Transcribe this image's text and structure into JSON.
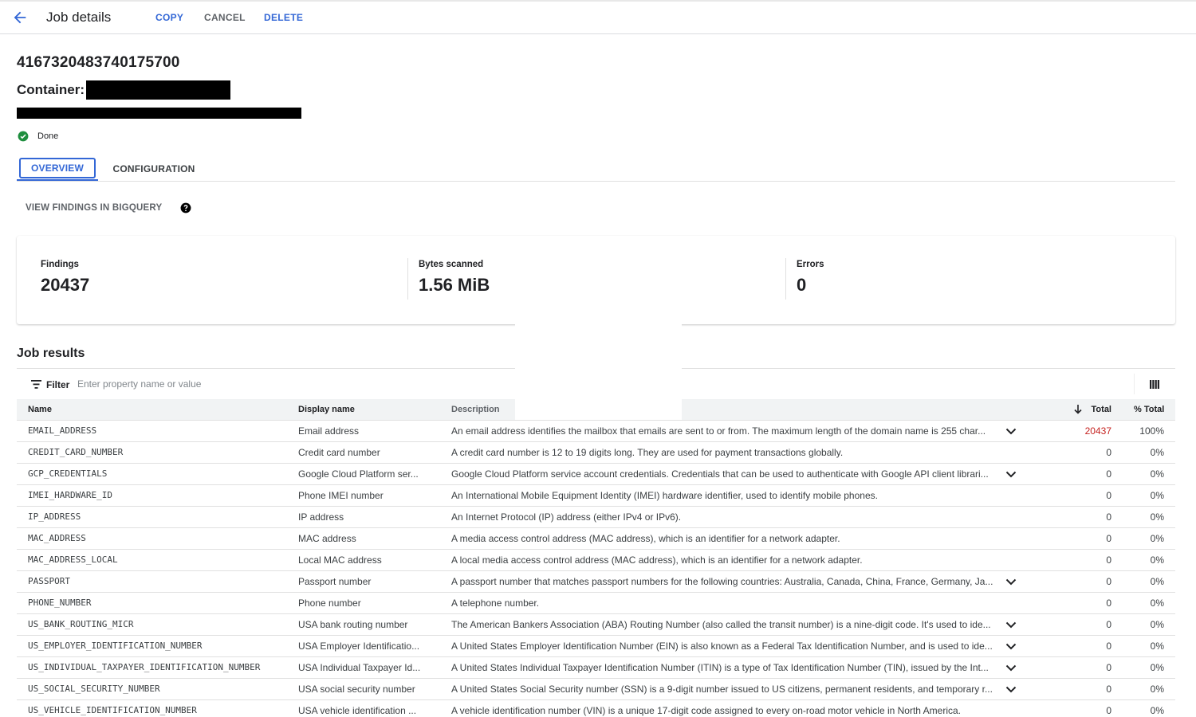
{
  "header": {
    "title": "Job details",
    "actions": {
      "copy": "COPY",
      "cancel": "CANCEL",
      "delete": "DELETE"
    }
  },
  "job": {
    "id": "4167320483740175700",
    "container_label": "Container:",
    "status": "Done"
  },
  "tabs": [
    {
      "label": "OVERVIEW",
      "active": true
    },
    {
      "label": "CONFIGURATION",
      "active": false
    }
  ],
  "bigquery_link": "VIEW FINDINGS IN BIGQUERY",
  "stats": [
    {
      "label": "Findings",
      "value": "20437"
    },
    {
      "label": "Bytes scanned",
      "value": "1.56 MiB"
    },
    {
      "label": "Errors",
      "value": "0"
    }
  ],
  "results": {
    "title": "Job results",
    "filter": {
      "label": "Filter",
      "placeholder": "Enter property name or value"
    },
    "columns": {
      "name": "Name",
      "display_name": "Display name",
      "description": "Description",
      "total": "Total",
      "pct_total": "% Total"
    },
    "rows": [
      {
        "name": "EMAIL_ADDRESS",
        "display": "Email address",
        "description": "An email address identifies the mailbox that emails are sent to or from. The maximum length of the domain name is 255 char...",
        "expandable": true,
        "total": "20437",
        "pct": "100%"
      },
      {
        "name": "CREDIT_CARD_NUMBER",
        "display": "Credit card number",
        "description": "A credit card number is 12 to 19 digits long. They are used for payment transactions globally.",
        "expandable": false,
        "total": "0",
        "pct": "0%"
      },
      {
        "name": "GCP_CREDENTIALS",
        "display": "Google Cloud Platform ser...",
        "description": "Google Cloud Platform service account credentials. Credentials that can be used to authenticate with Google API client librari...",
        "expandable": true,
        "total": "0",
        "pct": "0%"
      },
      {
        "name": "IMEI_HARDWARE_ID",
        "display": "Phone IMEI number",
        "description": "An International Mobile Equipment Identity (IMEI) hardware identifier, used to identify mobile phones.",
        "expandable": false,
        "total": "0",
        "pct": "0%"
      },
      {
        "name": "IP_ADDRESS",
        "display": "IP address",
        "description": "An Internet Protocol (IP) address (either IPv4 or IPv6).",
        "expandable": false,
        "total": "0",
        "pct": "0%"
      },
      {
        "name": "MAC_ADDRESS",
        "display": "MAC address",
        "description": "A media access control address (MAC address), which is an identifier for a network adapter.",
        "expandable": false,
        "total": "0",
        "pct": "0%"
      },
      {
        "name": "MAC_ADDRESS_LOCAL",
        "display": "Local MAC address",
        "description": "A local media access control address (MAC address), which is an identifier for a network adapter.",
        "expandable": false,
        "total": "0",
        "pct": "0%"
      },
      {
        "name": "PASSPORT",
        "display": "Passport number",
        "description": "A passport number that matches passport numbers for the following countries: Australia, Canada, China, France, Germany, Ja...",
        "expandable": true,
        "total": "0",
        "pct": "0%"
      },
      {
        "name": "PHONE_NUMBER",
        "display": "Phone number",
        "description": "A telephone number.",
        "expandable": false,
        "total": "0",
        "pct": "0%"
      },
      {
        "name": "US_BANK_ROUTING_MICR",
        "display": "USA bank routing number",
        "description": "The American Bankers Association (ABA) Routing Number (also called the transit number) is a nine-digit code. It's used to ide...",
        "expandable": true,
        "total": "0",
        "pct": "0%"
      },
      {
        "name": "US_EMPLOYER_IDENTIFICATION_NUMBER",
        "display": "USA Employer Identificatio...",
        "description": "A United States Employer Identification Number (EIN) is also known as a Federal Tax Identification Number, and is used to ide...",
        "expandable": true,
        "total": "0",
        "pct": "0%"
      },
      {
        "name": "US_INDIVIDUAL_TAXPAYER_IDENTIFICATION_NUMBER",
        "display": "USA Individual Taxpayer Id...",
        "description": "A United States Individual Taxpayer Identification Number (ITIN) is a type of Tax Identification Number (TIN), issued by the Int...",
        "expandable": true,
        "total": "0",
        "pct": "0%"
      },
      {
        "name": "US_SOCIAL_SECURITY_NUMBER",
        "display": "USA social security number",
        "description": "A United States Social Security number (SSN) is a 9-digit number issued to US citizens, permanent residents, and temporary r...",
        "expandable": true,
        "total": "0",
        "pct": "0%"
      },
      {
        "name": "US_VEHICLE_IDENTIFICATION_NUMBER",
        "display": "USA vehicle identification ...",
        "description": "A vehicle identification number (VIN) is a unique 17-digit code assigned to every on-road motor vehicle in North America.",
        "expandable": false,
        "total": "0",
        "pct": "0%"
      }
    ]
  },
  "colors": {
    "accent": "#3367d6",
    "success": "#1e8e3e",
    "highlight_total": "#c5221f"
  }
}
